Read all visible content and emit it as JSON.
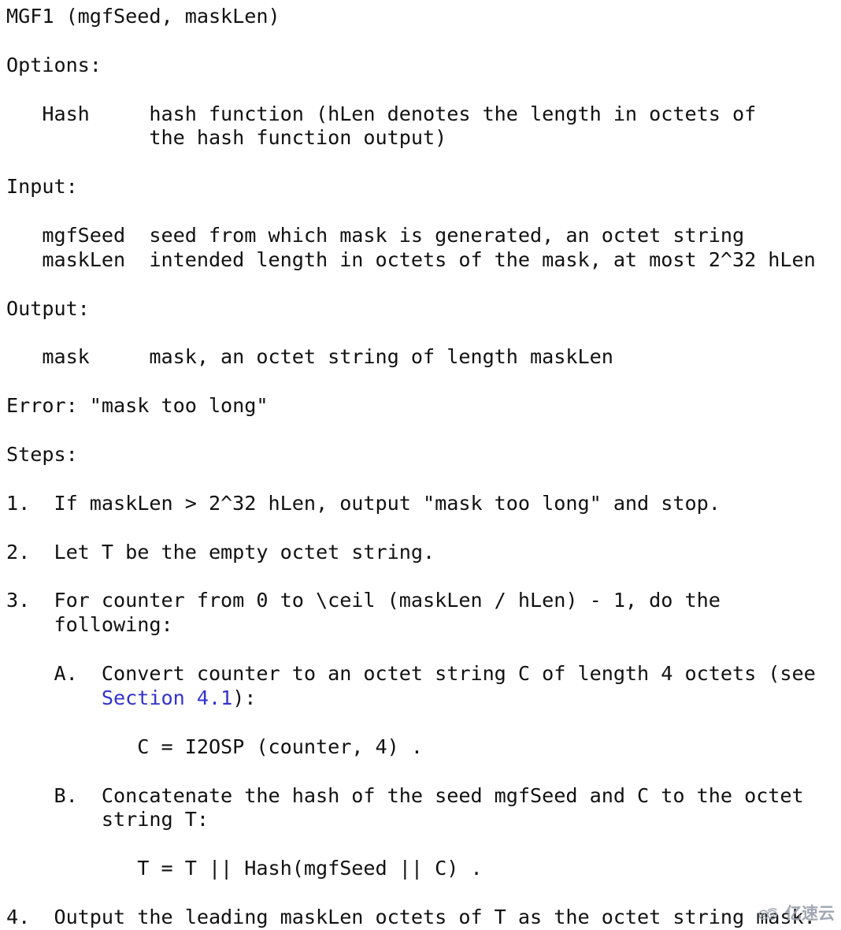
{
  "document": {
    "kind": "rfc-plaintext-spec",
    "title_line": "MGF1 (mgfSeed, maskLen)",
    "background_color": "#ffffff",
    "text_color": "#111111",
    "link_color": "#3333cc",
    "lines": [
      {
        "id": "title",
        "text": "MGF1 (mgfSeed, maskLen)"
      },
      {
        "id": "blank-1",
        "text": ""
      },
      {
        "id": "options-heading",
        "text": "Options:"
      },
      {
        "id": "blank-2",
        "text": ""
      },
      {
        "id": "option-hash-1",
        "text": "   Hash     hash function (hLen denotes the length in octets of"
      },
      {
        "id": "option-hash-2",
        "text": "            the hash function output)"
      },
      {
        "id": "blank-3",
        "text": ""
      },
      {
        "id": "input-heading",
        "text": "Input:"
      },
      {
        "id": "blank-4",
        "text": ""
      },
      {
        "id": "input-mgfseed",
        "text": "   mgfSeed  seed from which mask is generated, an octet string"
      },
      {
        "id": "input-masklen",
        "text": "   maskLen  intended length in octets of the mask, at most 2^32 hLen"
      },
      {
        "id": "blank-5",
        "text": ""
      },
      {
        "id": "output-heading",
        "text": "Output:"
      },
      {
        "id": "blank-6",
        "text": ""
      },
      {
        "id": "output-mask",
        "text": "   mask     mask, an octet string of length maskLen"
      },
      {
        "id": "blank-7",
        "text": ""
      },
      {
        "id": "error-line",
        "text": "Error: \"mask too long\""
      },
      {
        "id": "blank-8",
        "text": ""
      },
      {
        "id": "steps-heading",
        "text": "Steps:"
      },
      {
        "id": "blank-9",
        "text": ""
      },
      {
        "id": "step-1",
        "text": "1.  If maskLen > 2^32 hLen, output \"mask too long\" and stop."
      },
      {
        "id": "blank-10",
        "text": ""
      },
      {
        "id": "step-2",
        "text": "2.  Let T be the empty octet string."
      },
      {
        "id": "blank-11",
        "text": ""
      },
      {
        "id": "step-3-a",
        "text": "3.  For counter from 0 to \\ceil (maskLen / hLen) - 1, do the"
      },
      {
        "id": "step-3-b",
        "text": "    following:"
      },
      {
        "id": "blank-12",
        "text": ""
      },
      {
        "id": "step-3A-a",
        "text": "    A.  Convert counter to an octet string C of length 4 octets (see"
      },
      {
        "id": "blank-13",
        "text": ""
      },
      {
        "id": "step-3A-eq",
        "text": "           C = I2OSP (counter, 4) ."
      },
      {
        "id": "blank-14",
        "text": ""
      },
      {
        "id": "step-3B-a",
        "text": "    B.  Concatenate the hash of the seed mgfSeed and C to the octet"
      },
      {
        "id": "step-3B-b",
        "text": "        string T:"
      },
      {
        "id": "blank-15",
        "text": ""
      },
      {
        "id": "step-3B-eq",
        "text": "           T = T || Hash(mgfSeed || C) ."
      },
      {
        "id": "blank-16",
        "text": ""
      },
      {
        "id": "step-4",
        "text": "4.  Output the leading maskLen octets of T as the octet string mask."
      }
    ],
    "link_line": {
      "id": "step-3A-b",
      "indent": "        ",
      "link_text": "Section 4.1",
      "suffix": "):"
    }
  },
  "watermark": {
    "icon": "cloud-logo-icon",
    "text": "亿速云",
    "color": "#9aa0ac"
  }
}
